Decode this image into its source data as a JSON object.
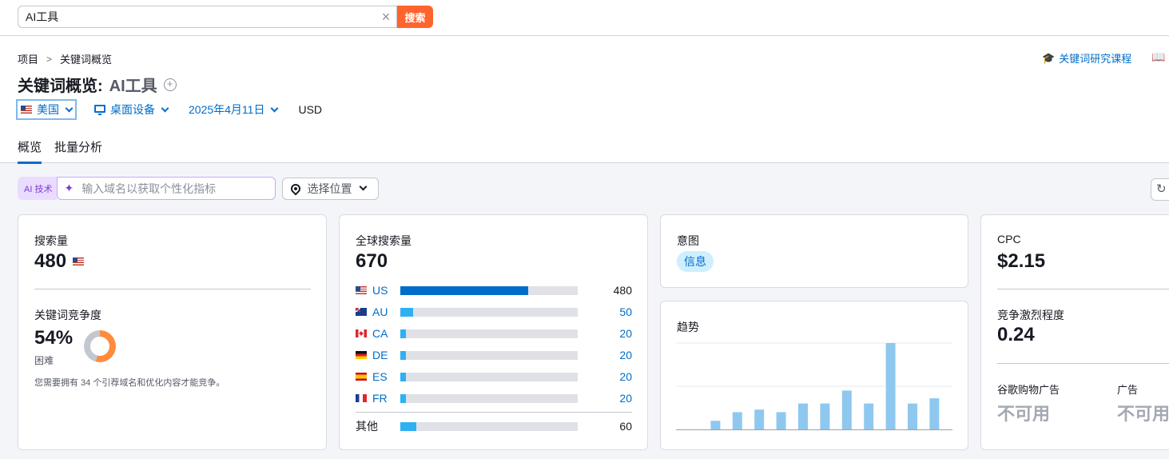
{
  "search": {
    "value": "AI工具",
    "button": "搜索"
  },
  "breadcrumb": {
    "root": "项目",
    "current": "关键词概览"
  },
  "header_links": {
    "course": "关键词研究课程"
  },
  "title": {
    "prefix": "关键词概览:",
    "keyword": "AI工具"
  },
  "filters": {
    "country": "美国",
    "device": "桌面设备",
    "date": "2025年4月11日",
    "currency": "USD"
  },
  "tabs": [
    {
      "label": "概览"
    },
    {
      "label": "批量分析"
    }
  ],
  "ai": {
    "tag": "AI 技术",
    "placeholder": "输入域名以获取个性化指标",
    "location": "选择位置"
  },
  "volume_card": {
    "label": "搜索量",
    "value": "480",
    "kd_label": "关键词竞争度",
    "kd_value": "54%",
    "kd_level": "困难",
    "kd_percent": 54,
    "kd_note": "您需要拥有 34 个引荐域名和优化内容才能竞争。"
  },
  "global_card": {
    "label": "全球搜索量",
    "value": "670",
    "rows": [
      {
        "code": "US",
        "value": "480",
        "share": 0.72,
        "flag": "flag-us"
      },
      {
        "code": "AU",
        "value": "50",
        "share": 0.07,
        "flag": "flag-au"
      },
      {
        "code": "CA",
        "value": "20",
        "share": 0.03,
        "flag": "flag-ca"
      },
      {
        "code": "DE",
        "value": "20",
        "share": 0.03,
        "flag": "flag-de"
      },
      {
        "code": "ES",
        "value": "20",
        "share": 0.03,
        "flag": "flag-es"
      },
      {
        "code": "FR",
        "value": "20",
        "share": 0.03,
        "flag": "flag-fr"
      }
    ],
    "other": {
      "label": "其他",
      "value": "60",
      "share": 0.09
    }
  },
  "intent_card": {
    "label": "意图",
    "pill": "信息"
  },
  "trend_card": {
    "label": "趋势",
    "chart_data": {
      "type": "bar",
      "values": [
        0.0,
        0.1,
        0.2,
        0.23,
        0.2,
        0.3,
        0.3,
        0.45,
        0.3,
        1.0,
        0.3,
        0.36
      ],
      "ylim": [
        0,
        1
      ],
      "grid": true
    }
  },
  "cpc_card": {
    "label": "CPC",
    "value": "$2.15",
    "comp_label": "竞争激烈程度",
    "comp_value": "0.24",
    "shopping_label": "谷歌购物广告",
    "shopping_value": "不可用",
    "ads_label": "广告",
    "ads_value": "不可用"
  },
  "colors": {
    "accent": "#006dca",
    "search_btn": "#ff642d",
    "bar_primary": "#006dca",
    "bar_secondary": "#2fb0f3",
    "trend_bar": "#8fc8ef",
    "kd_hard": "#ff8c3b"
  }
}
